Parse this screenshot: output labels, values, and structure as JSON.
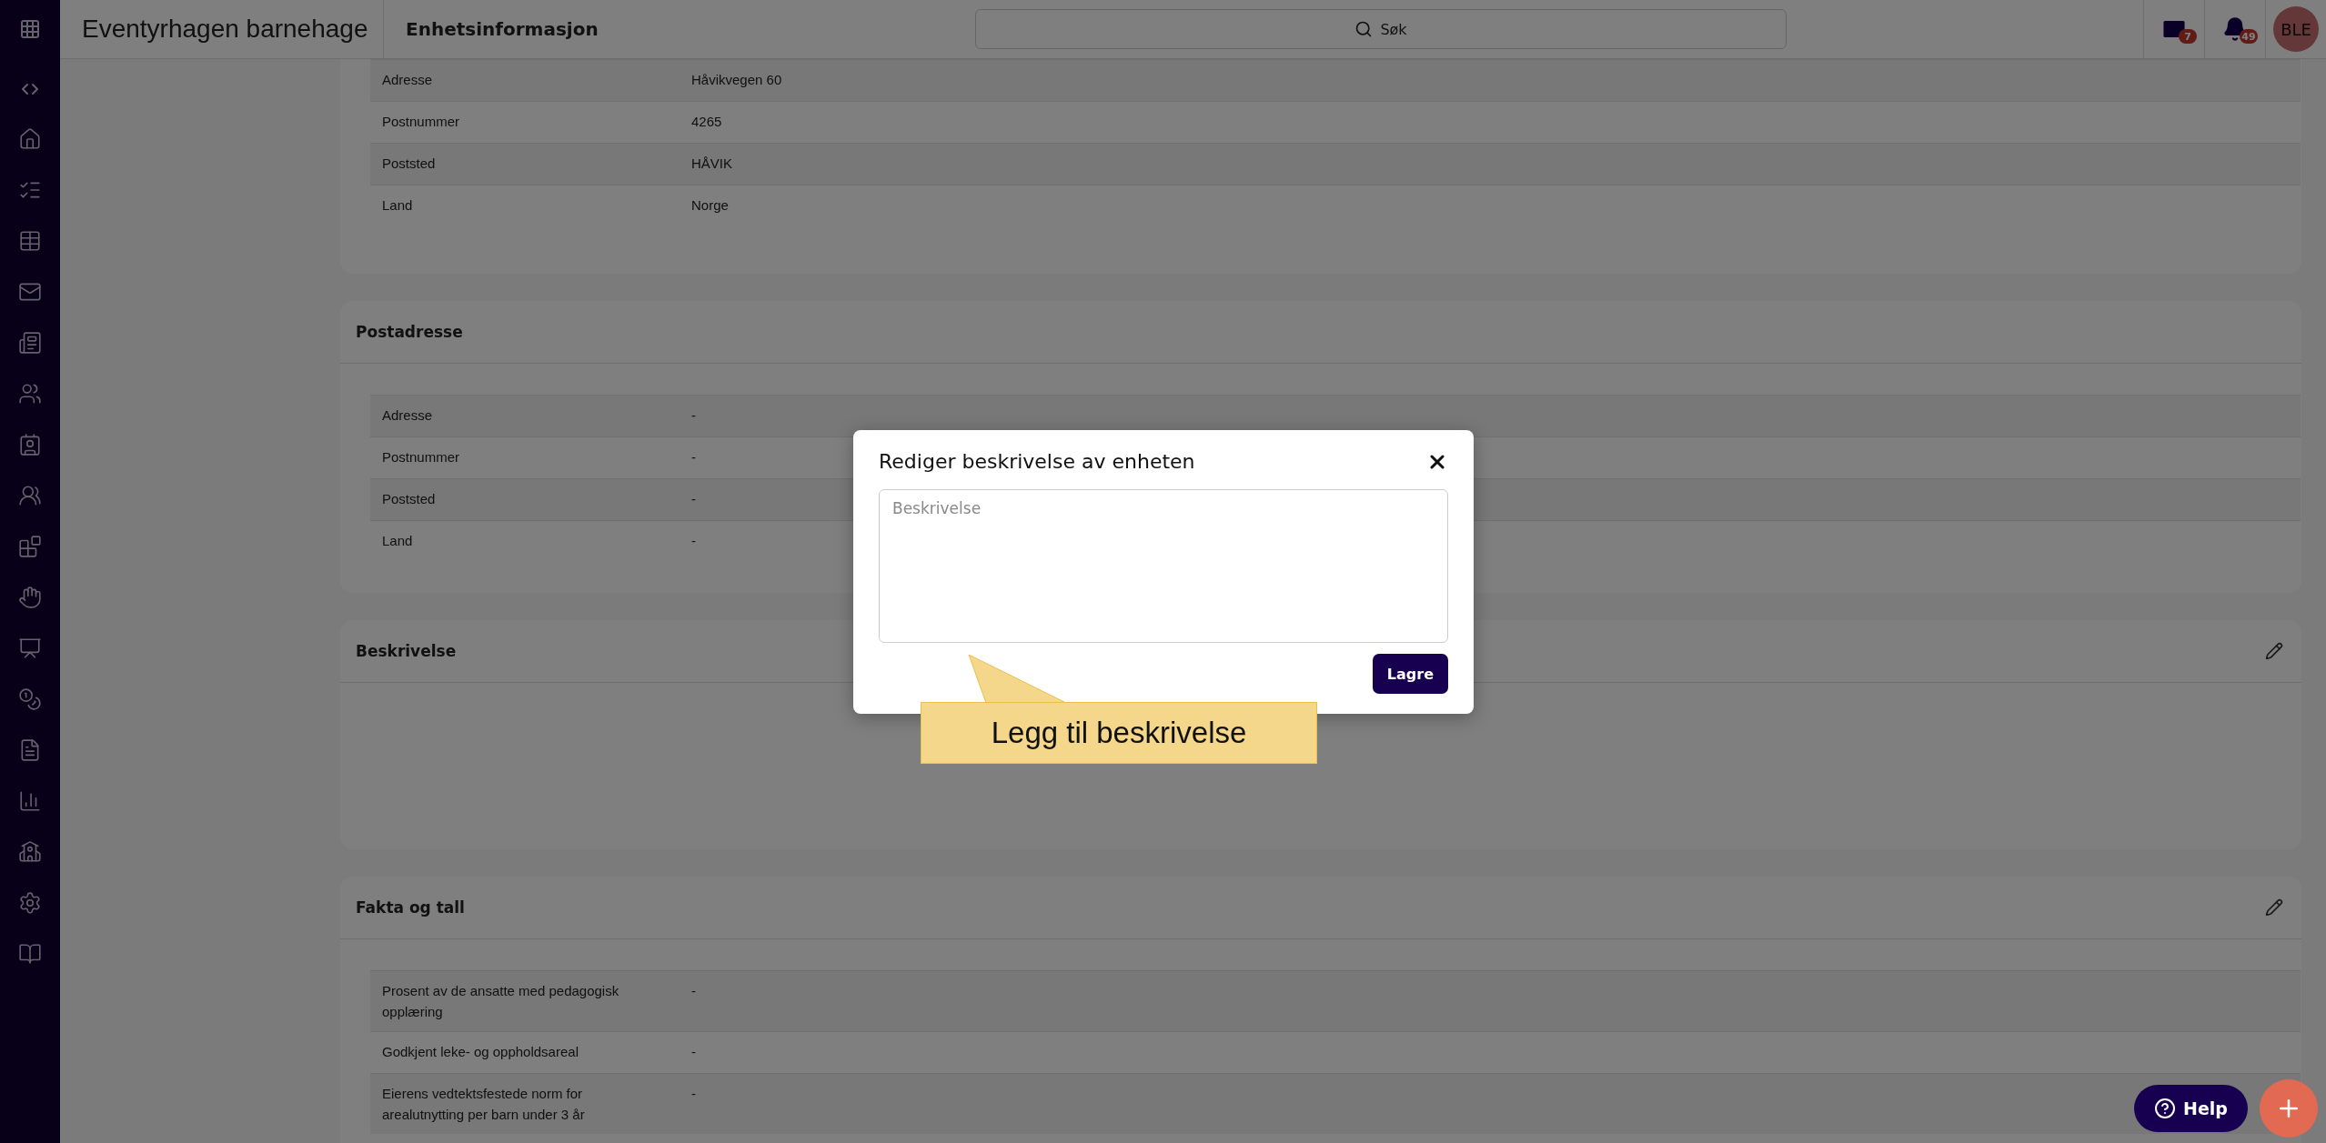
{
  "topbar": {
    "title": "Eventyrhagen barnehage",
    "page_title": "Enhetsinformasjon",
    "search": {
      "placeholder": "Søk"
    },
    "messages_badge": "7",
    "notifications_badge": "49",
    "avatar": "BLE"
  },
  "sections": [
    {
      "rows": [
        {
          "label": "Adresse",
          "value": "Håvikvegen 60"
        },
        {
          "label": "Postnummer",
          "value": "4265"
        },
        {
          "label": "Poststed",
          "value": "HÅVIK"
        },
        {
          "label": "Land",
          "value": "Norge"
        }
      ]
    },
    {
      "title": "Postadresse",
      "editable": false,
      "rows": [
        {
          "label": "Adresse",
          "value": "-"
        },
        {
          "label": "Postnummer",
          "value": "-"
        },
        {
          "label": "Poststed",
          "value": "-"
        },
        {
          "label": "Land",
          "value": "-"
        }
      ]
    },
    {
      "title": "Beskrivelse",
      "editable": true
    },
    {
      "title": "Fakta og tall",
      "editable": true,
      "rows": [
        {
          "label": "Prosent av de ansatte med pedagogisk opplæring",
          "value": "-"
        },
        {
          "label": "Godkjent leke- og oppholdsareal",
          "value": "-"
        },
        {
          "label": "Eierens vedtektsfestede norm for arealutnytting per barn under 3 år",
          "value": "-"
        }
      ]
    }
  ],
  "modal": {
    "title": "Rediger beskrivelse av enheten",
    "field": {
      "placeholder": "Beskrivelse"
    },
    "save_button": "Lagre"
  },
  "callout": {
    "text": "Legg til beskrivelse"
  },
  "help_button": "Help"
}
